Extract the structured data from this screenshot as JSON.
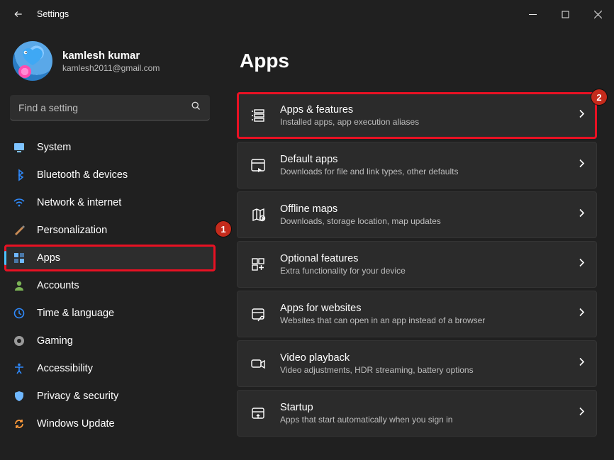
{
  "window": {
    "title": "Settings"
  },
  "profile": {
    "name": "kamlesh kumar",
    "email": "kamlesh2011@gmail.com"
  },
  "search": {
    "placeholder": "Find a setting"
  },
  "sidebar": {
    "items": [
      {
        "label": "System",
        "icon": "system",
        "active": false
      },
      {
        "label": "Bluetooth & devices",
        "icon": "bluetooth",
        "active": false
      },
      {
        "label": "Network & internet",
        "icon": "wifi",
        "active": false
      },
      {
        "label": "Personalization",
        "icon": "personalization",
        "active": false
      },
      {
        "label": "Apps",
        "icon": "apps",
        "active": true
      },
      {
        "label": "Accounts",
        "icon": "accounts",
        "active": false
      },
      {
        "label": "Time & language",
        "icon": "time",
        "active": false
      },
      {
        "label": "Gaming",
        "icon": "gaming",
        "active": false
      },
      {
        "label": "Accessibility",
        "icon": "accessibility",
        "active": false
      },
      {
        "label": "Privacy & security",
        "icon": "privacy",
        "active": false
      },
      {
        "label": "Windows Update",
        "icon": "update",
        "active": false
      }
    ]
  },
  "page": {
    "title": "Apps",
    "cards": [
      {
        "title": "Apps & features",
        "subtitle": "Installed apps, app execution aliases",
        "icon": "apps-features",
        "highlight": true
      },
      {
        "title": "Default apps",
        "subtitle": "Downloads for file and link types, other defaults",
        "icon": "default-apps",
        "highlight": false
      },
      {
        "title": "Offline maps",
        "subtitle": "Downloads, storage location, map updates",
        "icon": "offline-maps",
        "highlight": false
      },
      {
        "title": "Optional features",
        "subtitle": "Extra functionality for your device",
        "icon": "optional",
        "highlight": false
      },
      {
        "title": "Apps for websites",
        "subtitle": "Websites that can open in an app instead of a browser",
        "icon": "websites",
        "highlight": false
      },
      {
        "title": "Video playback",
        "subtitle": "Video adjustments, HDR streaming, battery options",
        "icon": "video",
        "highlight": false
      },
      {
        "title": "Startup",
        "subtitle": "Apps that start automatically when you sign in",
        "icon": "startup",
        "highlight": false
      }
    ]
  },
  "annotations": {
    "marker1": "1",
    "marker2": "2"
  }
}
